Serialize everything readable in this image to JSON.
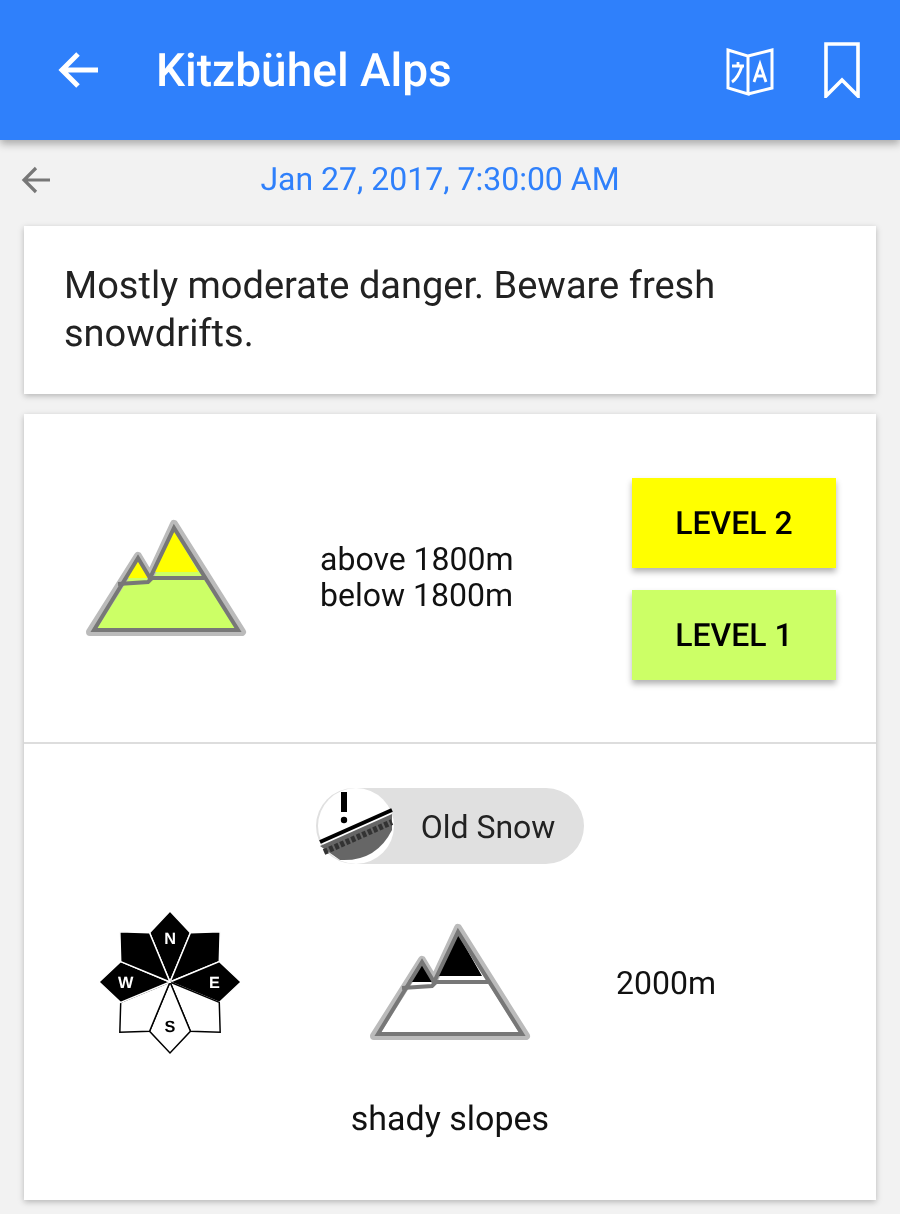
{
  "app_bar": {
    "title": "Kitzbühel Alps"
  },
  "date_row": {
    "date": "Jan 27, 2017, 7:30:00 AM"
  },
  "highlights": "Mostly moderate danger. Beware fresh snowdrifts.",
  "danger": {
    "elevations": [
      "above 1800m",
      "below 1800m"
    ],
    "levels": [
      {
        "label": "LEVEL 2",
        "color": "#ffff00"
      },
      {
        "label": "LEVEL 1",
        "color": "#ccff66"
      }
    ]
  },
  "problem": {
    "label": "Old Snow",
    "elevation": "2000m",
    "aspect_text": "shady slopes",
    "sectors": [
      {
        "label": "N",
        "on": true
      },
      {
        "on": true
      },
      {
        "label": "E",
        "on": true
      },
      {
        "on": false
      },
      {
        "label": "S",
        "on": false
      },
      {
        "on": false
      },
      {
        "label": "W",
        "on": true
      },
      {
        "on": true
      }
    ]
  }
}
